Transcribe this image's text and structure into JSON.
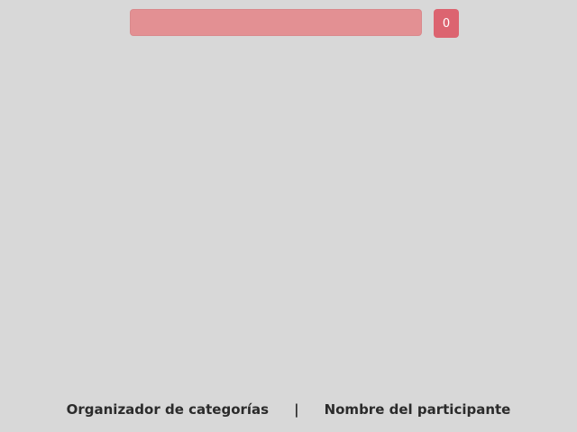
{
  "progress": {
    "fraction": 0.0,
    "track_color": "#e39093"
  },
  "counter": {
    "value": "0",
    "color": "#dc6470"
  },
  "footer": {
    "left_label": "Organizador de categorías",
    "separator": "|",
    "right_label": "Nombre del participante"
  }
}
